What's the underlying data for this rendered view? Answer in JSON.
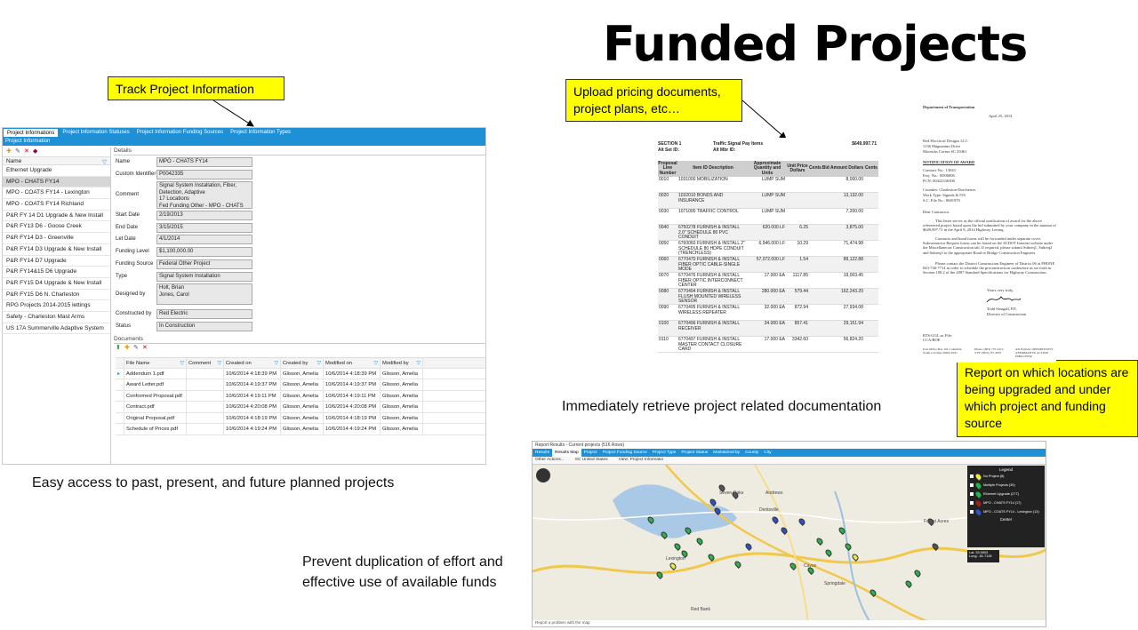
{
  "slide": {
    "title": "Funded Projects",
    "callouts": {
      "track": "Track Project Information",
      "upload": "Upload pricing documents, project plans, etc…",
      "report": "Report on which locations are being upgraded and under which project and funding source"
    },
    "captions": {
      "easy_access": "Easy access to past, present, and future planned projects",
      "retrieve": "Immediately retrieve project related documentation",
      "prevent_line1": "Prevent duplication of effort and",
      "prevent_line2": "effective use of available funds"
    }
  },
  "app": {
    "tabs": [
      "Project Informations",
      "Project Information Statuses",
      "Project Information Funding Sources",
      "Project Information Types"
    ],
    "section_title": "Project Information",
    "list_header": "Name",
    "projects": [
      "Ethernet Upgrade",
      "MPO - CHATS FY14",
      "MPO - COATS FY14 - Lexington",
      "MPO - COATS FY14 Richland",
      "P&R FY 14 D1 Upgrade & New Install",
      "P&R FY13 D6 - Goose Creek",
      "P&R FY14 D3 - Greenville",
      "P&R FY14 D3 Upgrade & New Install",
      "P&R FY14 D7 Upgrade",
      "P&R FY14&15 D6 Upgrade",
      "P&R FY15 D4 Upgrade & New Install",
      "P&R FY15 D6 N. Charleston",
      "RPG Projects 2014-2015 lettings",
      "Safety - Charleston Mast Arms",
      "US 17A Summerville Adaptive System"
    ],
    "details_title": "Details",
    "details": {
      "name_label": "Name",
      "name": "MPO - CHATS FY14",
      "custom_id_label": "Custom Identifier",
      "custom_id": "P0042335",
      "comment_label": "Comment",
      "comment": "Signal System Installation, Fiber,\nDetection, Adaptive\n17 Locations\nFed Funding Other - MPO - CHATS",
      "start_label": "Start Date",
      "start": "2/19/2013",
      "end_label": "End Date",
      "end": "3/15/2015",
      "let_label": "Let Date",
      "let": "4/1/2014",
      "funding_level_label": "Funding Level",
      "funding_level": "$1,100,000.00",
      "funding_source_label": "Funding Source",
      "funding_source": "Federal Other Project",
      "type_label": "Type",
      "type": "Signal System Installation",
      "designed_label": "Designed by",
      "designed": "Holt, Brian\nJones, Carol",
      "constructed_label": "Constructed by",
      "constructed": "Red Electric",
      "status_label": "Status",
      "status": "In Construction"
    },
    "documents_title": "Documents",
    "doc_columns": [
      "File Name",
      "Comment",
      "Created on",
      "Created by",
      "Modified on",
      "Modified by"
    ],
    "documents": [
      [
        "Addendum 1.pdf",
        "",
        "10/6/2014 4:18:39 PM",
        "Glisson, Amelia",
        "10/6/2014 4:18:39 PM",
        "Glisson, Amelia"
      ],
      [
        "Award Letter.pdf",
        "",
        "10/6/2014 4:19:37 PM",
        "Glisson, Amelia",
        "10/6/2014 4:19:37 PM",
        "Glisson, Amelia"
      ],
      [
        "Conformed Proposal.pdf",
        "",
        "10/6/2014 4:19:11 PM",
        "Glisson, Amelia",
        "10/6/2014 4:19:11 PM",
        "Glisson, Amelia"
      ],
      [
        "Contract.pdf",
        "",
        "10/6/2014 4:20:08 PM",
        "Glisson, Amelia",
        "10/6/2014 4:20:08 PM",
        "Glisson, Amelia"
      ],
      [
        "Original Proposal.pdf",
        "",
        "10/6/2014 4:18:19 PM",
        "Glisson, Amelia",
        "10/6/2014 4:18:19 PM",
        "Glisson, Amelia"
      ],
      [
        "Schedule of Prices.pdf",
        "",
        "10/6/2014 4:19:24 PM",
        "Glisson, Amelia",
        "10/6/2014 4:19:24 PM",
        "Glisson, Amelia"
      ]
    ]
  },
  "bid_doc": {
    "section": "SECTION   1",
    "alt_set": "Alt Set ID:",
    "heading": "Traffic Signal Pay Items",
    "alt_mbr": "Alt Mbr ID:",
    "total": "$649,997.71",
    "columns": [
      "Proposal Line Number",
      "Item ID Description",
      "Approximate Quantity and Units",
      "Unit Price Dollars",
      "Cents",
      "Bid Amount Dollars",
      "Cents"
    ],
    "rows": [
      [
        "0010",
        "1031000 MOBILIZATION",
        "LUMP SUM",
        "",
        "",
        "8,000.00",
        ""
      ],
      [
        "0020",
        "1032010 BONDS AND INSURANCE",
        "LUMP SUM",
        "",
        "",
        "13,132.00",
        ""
      ],
      [
        "0030",
        "1071000 TRAFFIC CONTROL",
        "LUMP SUM",
        "",
        "",
        "7,200.00",
        ""
      ],
      [
        "0040",
        "6750278 FURNISH & INSTALL 2.0\" SCHEDULE 80 PVC CONDUIT",
        "620.000 LF",
        "6.25",
        "",
        "3,875.00",
        ""
      ],
      [
        "0050",
        "6760060 FURNISH & INSTALL 2\" SCHEDULE 80 HDPE CONDUIT (TRENCHLESS)",
        "6,946.000 LF",
        "10.29",
        "",
        "71,474.98",
        ""
      ],
      [
        "0060",
        "6770470 FURNISH & INSTALL FIBER OPTIC CABLE-SINGLE MODE",
        "57,072.000 LF",
        "1.54",
        "",
        "89,122.88",
        ""
      ],
      [
        "0070",
        "6770476 FURNISH & INSTALL FIBER OPTIC INTERCONNECT CENTER",
        "17.000 EA",
        "1117.85",
        "",
        "19,003.45",
        ""
      ],
      [
        "0080",
        "6770494 FURNISH & INSTALL FLUSH MOUNTED WIRELESS SENSOR",
        "280.000 EA",
        "579.44",
        "",
        "162,243.20",
        ""
      ],
      [
        "0090",
        "6770495 FURNISH & INSTALL WIRELESS REPEATER",
        "32.000 EA",
        "872.94",
        "",
        "27,934.08",
        ""
      ],
      [
        "0100",
        "6770496 FURNISH & INSTALL RECEIVER",
        "34.000 EA",
        "857.41",
        "",
        "29,151.94",
        ""
      ],
      [
        "0110",
        "6770497 FURNISH & INSTALL MASTER CONTACT CLOSURE CARD",
        "17.000 EA",
        "3342.60",
        "",
        "56,824.20",
        ""
      ]
    ]
  },
  "award_doc": {
    "dept": "Department of Transportation",
    "date": "April 25, 2014",
    "addr1": "Red Electrical Designs LLC",
    "addr2": "1136 Magnanimi Drive",
    "addr3": "Mooncks Corner SC 29461",
    "heading": "NOTIFICATION OF AWARD",
    "contract_no": "Contract No.:   13043",
    "proj_no": "Proj. No.:   SD06006",
    "pcn": "PCN:   00422336300",
    "counties": "Counties:   Charleston-Dorchester",
    "work_type": "Work Type:   Signals & ITS",
    "file_no": "S.C. File No.:   8681970",
    "salutation": "Dear Contractor:",
    "para1": "This letter serves as the official notification of award for the above referenced project based upon the bid submitted by your company in the amount of $649,997.71 in the April 8, 2014 Highway Letting.",
    "para2": "Contracts and bond forms will be forwarded under separate cover. Subcontractor Request forms can be found on the SCDOT Internet website under the Miscellaneous Construction tab. If required, please submit Subreq1, Subreq2 and Subreq3 to the appropriate Road or Bridge Construction Engineer.",
    "para3": "Please contact the District Construction Engineer of District 06 at PHONE 843-746-7714 in order to schedule the preconstruction conference as set forth in Section 108.2 of the 2007 Standard Specifications for Highway Construction.",
    "closing": "Yours very truly,",
    "signer": "Todd Steagall, P.E.",
    "signer_title": "Director of Construction",
    "cc": "RTS:GGL:ac   File: CCA/BOE",
    "footer1": "Post Office Box 191   Columbia, South Carolina 29202-0191",
    "footer2": "Phone: (803) 737-2314   TTY: (803) 737-3870",
    "footer3": "AN EQUAL OPPORTUNITY AFFIRMATIVE ACTION EMPLOYER"
  },
  "map": {
    "window_title": "Report Results - Current projects   (516 Rows)",
    "tabs": [
      "Results",
      "Results Map",
      "Project",
      "Project Funding Source",
      "Project Type",
      "Project Status",
      "Maintained by",
      "County",
      "City"
    ],
    "toolbar": [
      "Other Actions...",
      "SC United States",
      "View: Project Informatio"
    ],
    "legend_title": "Legend",
    "legend_items": [
      {
        "label": "No Project (8)",
        "color": "#e8e84a"
      },
      {
        "label": "Multiple Projects (39)",
        "color": "#2ab24a"
      },
      {
        "label": "Ethernet Upgrade (277)",
        "color": "#2ab24a"
      },
      {
        "label": "MPO - CHATS FY14 (17)",
        "color": "#a02020"
      },
      {
        "label": "MPO - COATS FY14 - Lexington (13)",
        "color": "#3050c8"
      }
    ],
    "center_label": "Center",
    "coords_lat": "Lat: 33.9903",
    "coords_long": "Long: -81.7128",
    "place_labels": [
      "Seven Oaks",
      "Dentsville",
      "Andrews",
      "Forest Acres",
      "Lexington",
      "Cayce",
      "Red Bank",
      "Springdale"
    ],
    "footer": "Report a problem with the map"
  },
  "colors": {
    "accent": "#1e90d6",
    "callout": "#ffff00"
  }
}
